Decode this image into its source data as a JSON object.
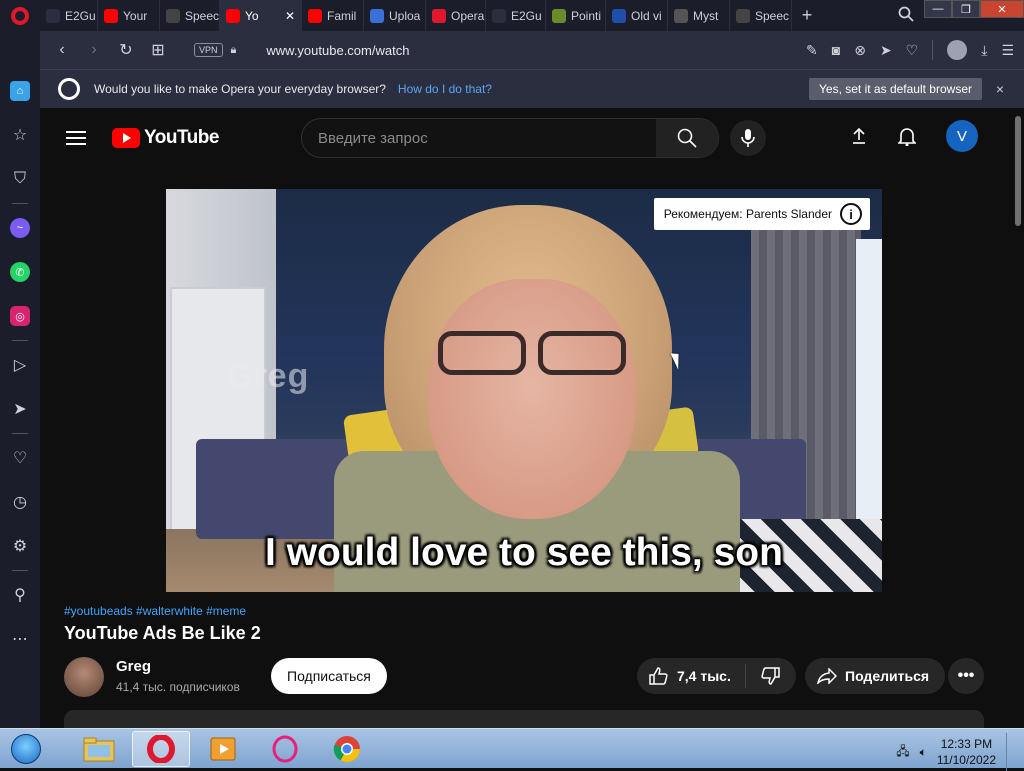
{
  "browser": {
    "tabs": [
      {
        "label": "E2Gu",
        "icon": "e2g-icon",
        "color": "#2b2e3e"
      },
      {
        "label": "Your",
        "icon": "youtube-icon",
        "color": "#ff0000"
      },
      {
        "label": "Speec",
        "icon": "speedometer-icon",
        "color": "#444"
      },
      {
        "label": "Yo",
        "icon": "youtube-icon",
        "color": "#ff0000",
        "active": true
      },
      {
        "label": "Famil",
        "icon": "youtube-icon",
        "color": "#ff0000"
      },
      {
        "label": "Uploa",
        "icon": "upload-icon",
        "color": "#3a6fd8"
      },
      {
        "label": "Opera",
        "icon": "opera-icon",
        "color": "#e0182d"
      },
      {
        "label": "E2Gu",
        "icon": "e2g-icon",
        "color": "#2b2e3e"
      },
      {
        "label": "Pointi",
        "icon": "pen-icon",
        "color": "#6b8a2a"
      },
      {
        "label": "Old vi",
        "icon": "ov-icon",
        "color": "#1f4fa8"
      },
      {
        "label": "Myst",
        "icon": "building-icon",
        "color": "#555"
      },
      {
        "label": "Speec",
        "icon": "grid-icon",
        "color": "#444"
      }
    ],
    "new_tab": "+",
    "url": "www.youtube.com/watch",
    "vpn_label": "VPN",
    "prompt": {
      "text": "Would you like to make Opera your everyday browser?",
      "link": "How do I do that?",
      "yes_button": "Yes, set it as default browser",
      "close": "×"
    }
  },
  "youtube": {
    "logo_text": "YouTube",
    "search_placeholder": "Введите запрос",
    "avatar_letter": "V",
    "video": {
      "watermark": "Greg",
      "subtitle": "I would love to see this, son",
      "recommendation": "Рекомендуем: Parents Slander",
      "info": "i"
    },
    "hashtags": "#youtubeads #walterwhite #meme",
    "title": "YouTube Ads Be Like 2",
    "channel": {
      "name": "Greg",
      "subscribers": "41,4 тыс. подписчиков"
    },
    "subscribe_label": "Подписаться",
    "likes": "7,4 тыс.",
    "share_label": "Поделиться",
    "more_label": "•••"
  },
  "taskbar": {
    "time": "12:33 PM",
    "date": "11/10/2022"
  }
}
